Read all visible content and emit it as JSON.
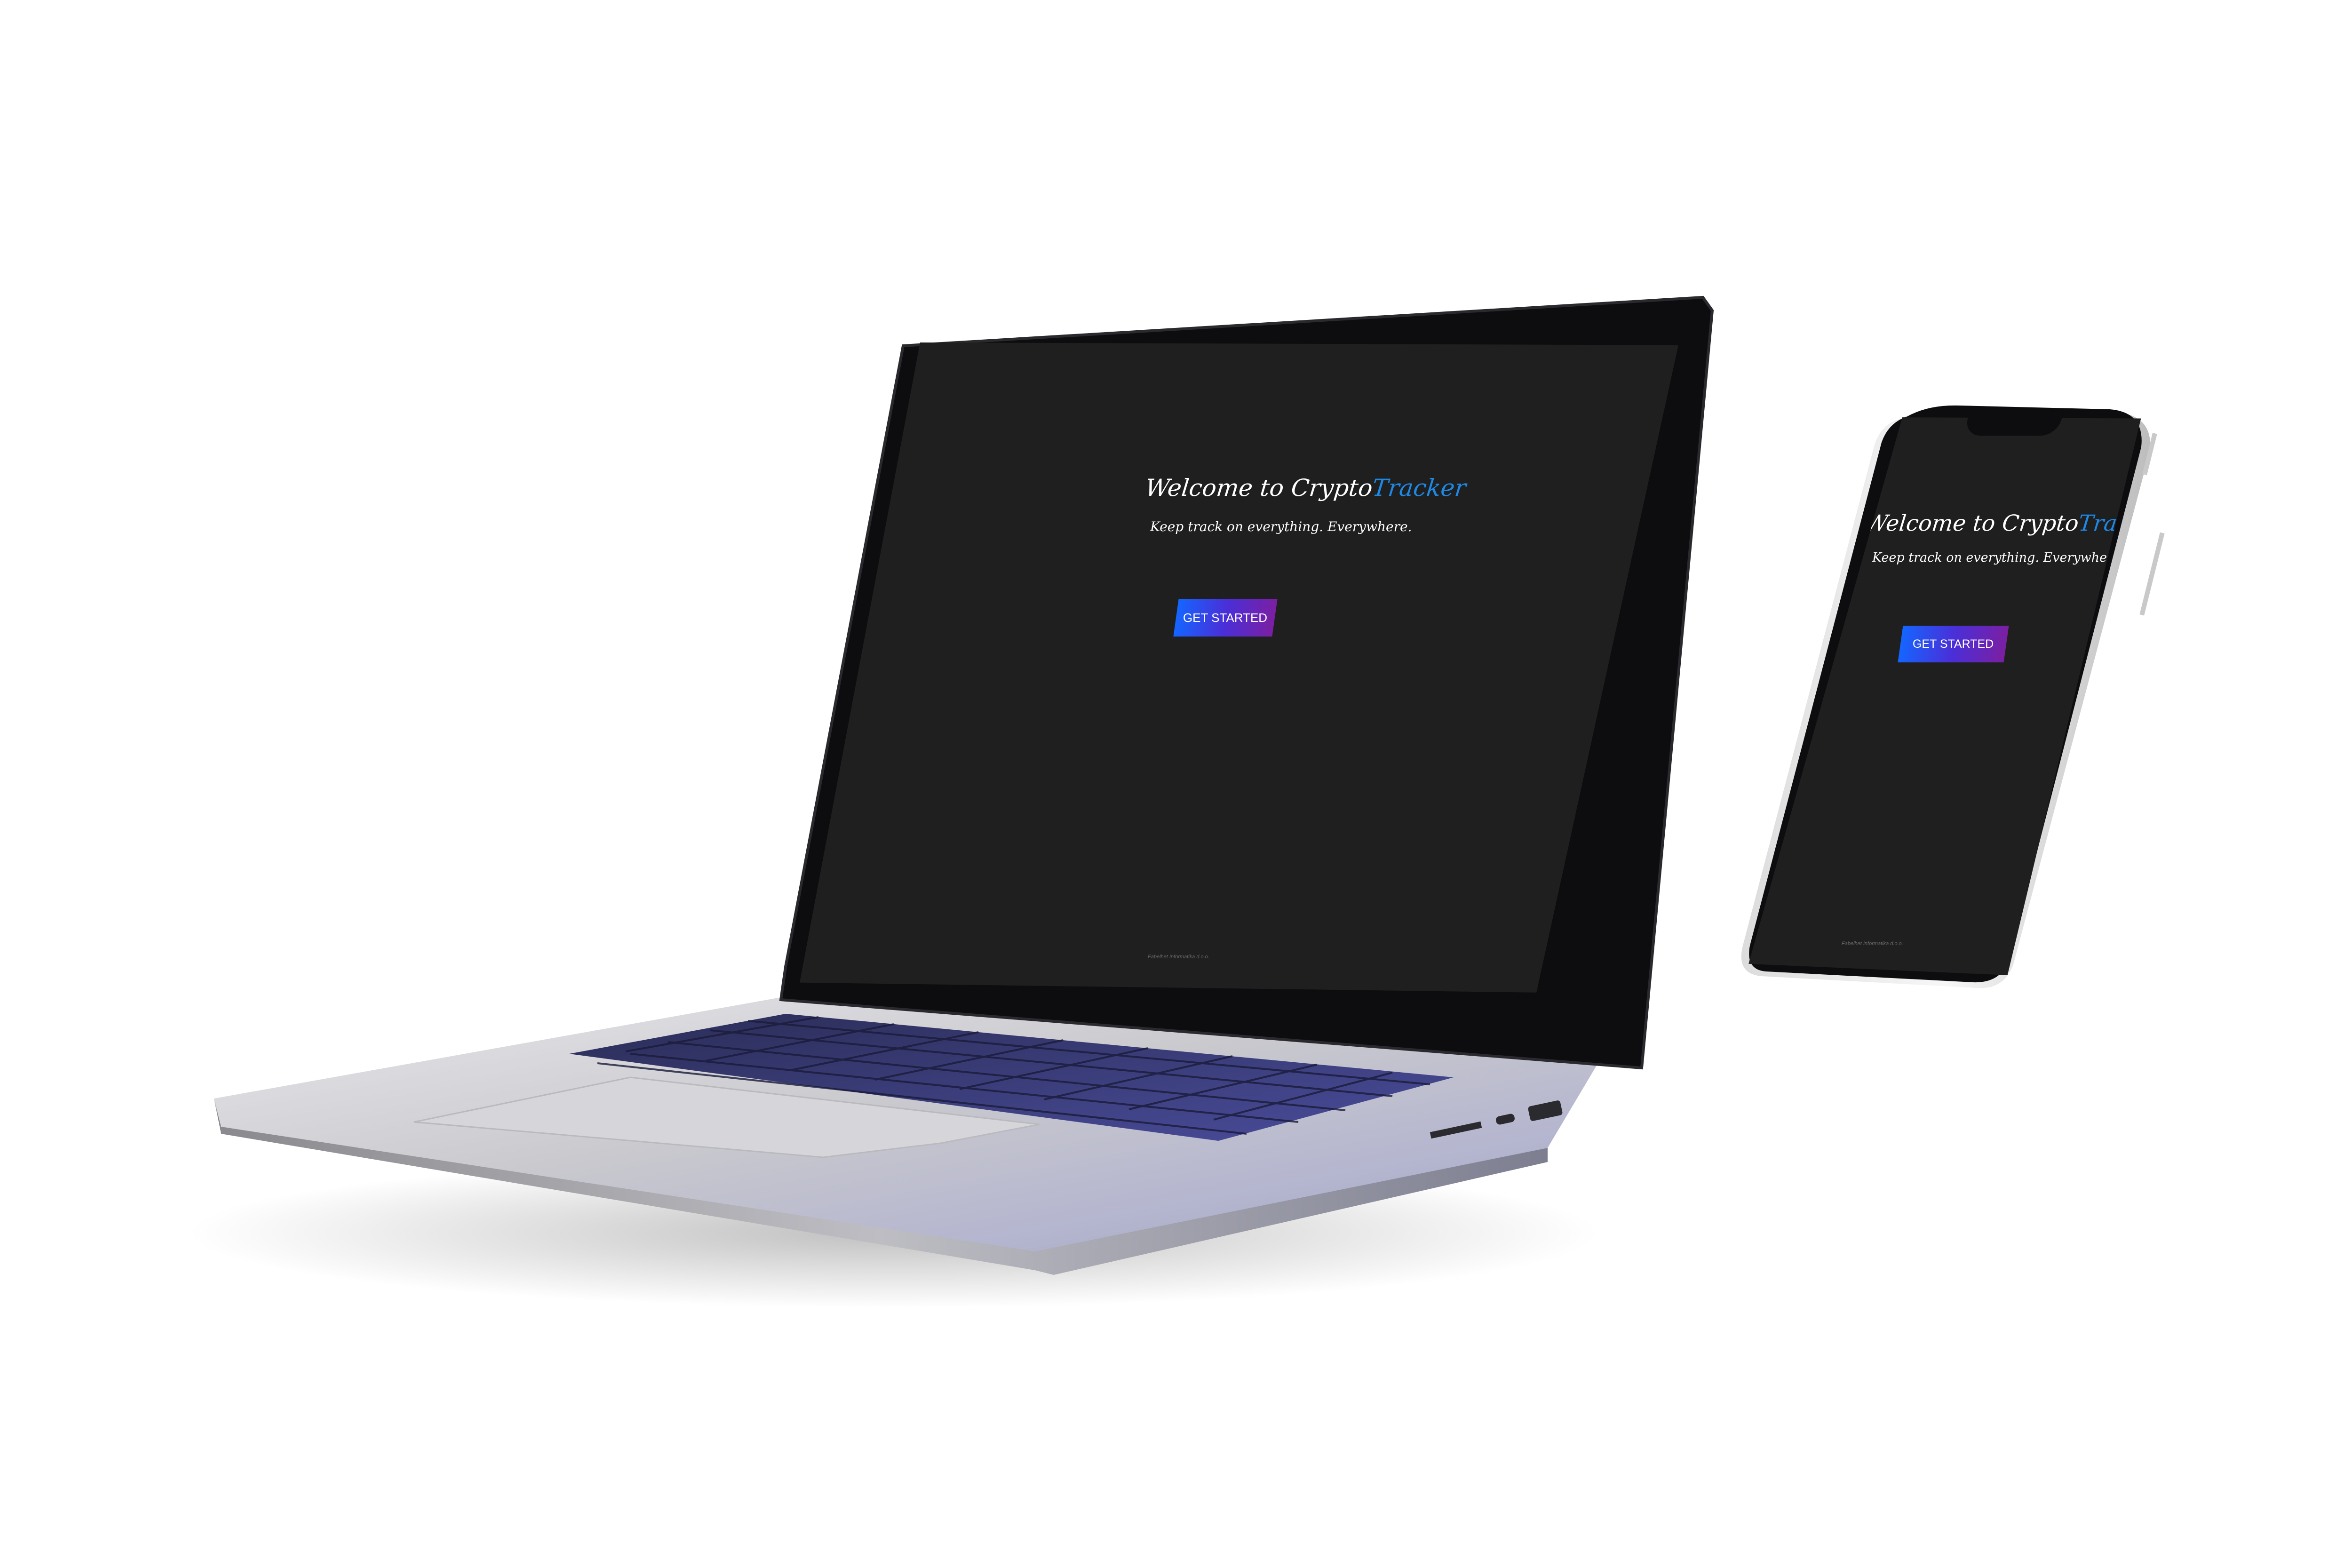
{
  "laptop_screen": {
    "welcome_prefix": "Welcome to Crypto",
    "welcome_accent": "Tracker",
    "tagline": "Keep track on everything. Everywhere.",
    "cta_label": "GET STARTED",
    "footer": "Fabelhet Informatika d.o.o."
  },
  "phone_screen": {
    "welcome_prefix": "Welcome to Crypto",
    "welcome_accent": "Tracker",
    "tagline": "Keep track on everything. Everywhere.",
    "cta_label": "GET STARTED",
    "footer": "Fabelhet Informatika d.o.o."
  },
  "colors": {
    "screen_bg": "#1f1f1f",
    "accent": "#1e88e5",
    "cta_gradient_start": "#1565ff",
    "cta_gradient_end": "#7b1fa2",
    "keyboard_tint": "#3d3f8f"
  }
}
